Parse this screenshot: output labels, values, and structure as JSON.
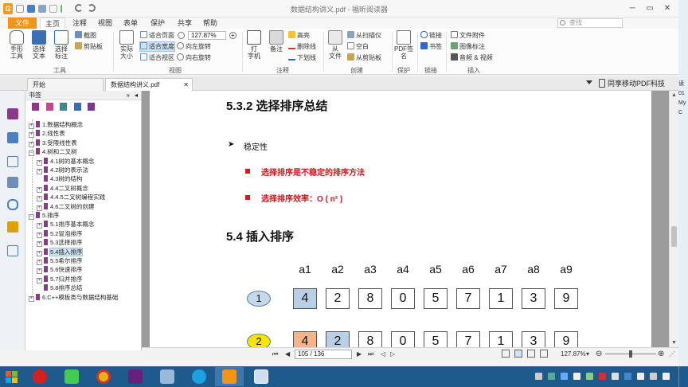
{
  "window": {
    "title": "数据结构讲义.pdf - 福昕阅读器",
    "minimize": "─",
    "restore": "▭",
    "close": "✕"
  },
  "menu": {
    "tabs": [
      "文件",
      "主页",
      "注释",
      "视图",
      "表单",
      "保护",
      "共享",
      "帮助"
    ],
    "search_placeholder": "查找"
  },
  "ribbon": {
    "tools": {
      "hand": "手形\n工具",
      "select_text": "选择\n文本",
      "select_annotation": "选择\n标注",
      "snapshot": "截图",
      "clipboard": "剪贴板",
      "group_label": "工具"
    },
    "view": {
      "actual_size": "实际\n大小",
      "fit_page": "适合页面",
      "fit_width": "适合宽度",
      "fit_visible": "适合视区",
      "zoom_value": "127.87%",
      "rotate_left": "向左旋转",
      "rotate_right": "向右旋转",
      "group_label": "视图"
    },
    "comment": {
      "typewriter": "打\n字机",
      "note": "备注",
      "highlight": "高亮",
      "strikeout": "删除线",
      "underline": "下划线",
      "group_label": "注释"
    },
    "create": {
      "from_file": "从\n文件",
      "from_scanner": "从扫描仪",
      "blank": "空白",
      "from_clipboard": "从剪贴板",
      "group_label": "创建"
    },
    "protect": {
      "pdf_sign": "PDF签\n名",
      "group_label": "保护"
    },
    "links": {
      "link": "链接",
      "bookmark": "书签",
      "group_label": "链接"
    },
    "insert": {
      "file_attachment": "文件附件",
      "image_annotation": "图像标注",
      "audio_video": "音频 & 视频",
      "group_label": "插入"
    }
  },
  "doc_tabs": [
    {
      "label": "开始",
      "close": ""
    },
    {
      "label": "数据结构讲义.pdf",
      "close": "✕"
    }
  ],
  "share_label": "同享移动PDF科技",
  "bookmarks": {
    "title": "书签",
    "items": [
      {
        "label": "1.数据结构概念",
        "level": 0,
        "expander": "+"
      },
      {
        "label": "2.线性表",
        "level": 0,
        "expander": "+"
      },
      {
        "label": "3.受限线性表",
        "level": 0,
        "expander": "+"
      },
      {
        "label": "4.树和二叉树",
        "level": 0,
        "expander": "−"
      },
      {
        "label": "4.1树的基本概念",
        "level": 1,
        "expander": "+"
      },
      {
        "label": "4.2树的表示法",
        "level": 1,
        "expander": "+"
      },
      {
        "label": "4.3树的结构",
        "level": 1,
        "expander": ""
      },
      {
        "label": "4.4二叉树概念",
        "level": 1,
        "expander": "+"
      },
      {
        "label": "4.4.5二叉树编程实践",
        "level": 1,
        "expander": "+"
      },
      {
        "label": "4.6二叉树的创建",
        "level": 1,
        "expander": "+"
      },
      {
        "label": "5.排序",
        "level": 0,
        "expander": "−"
      },
      {
        "label": "5.1排序基本概念",
        "level": 1,
        "expander": "+"
      },
      {
        "label": "5.2冒泡排序",
        "level": 1,
        "expander": "+"
      },
      {
        "label": "5.3选择排序",
        "level": 1,
        "expander": "+"
      },
      {
        "label": "5.4插入排序",
        "level": 1,
        "expander": "+",
        "selected": true
      },
      {
        "label": "5.5希尔排序",
        "level": 1,
        "expander": "+"
      },
      {
        "label": "5.6快速排序",
        "level": 1,
        "expander": "+"
      },
      {
        "label": "5.7归并排序",
        "level": 1,
        "expander": "+"
      },
      {
        "label": "5.8排序总结",
        "level": 1,
        "expander": ""
      },
      {
        "label": "6.C++模板类与数据结构基础",
        "level": 0,
        "expander": "+"
      }
    ]
  },
  "page": {
    "heading1": "5.3.2 选择排序总结",
    "bullet_marker": "➤",
    "bullet1": "稳定性",
    "red1": "选择排序是不稳定的排序方法",
    "red2": "选择排序效率：O ( n² )",
    "heading2": "5.4 插入排序",
    "columns": [
      "a1",
      "a2",
      "a3",
      "a4",
      "a5",
      "a6",
      "a7",
      "a8",
      "a9"
    ],
    "rows": [
      {
        "step": "1",
        "values": [
          "4",
          "2",
          "8",
          "0",
          "5",
          "7",
          "1",
          "3",
          "9"
        ],
        "highlight": [
          0
        ],
        "highlight_color": "blue"
      },
      {
        "step": "2",
        "values": [
          "4",
          "2",
          "8",
          "0",
          "5",
          "7",
          "1",
          "3",
          "9"
        ],
        "highlight": [
          0,
          1
        ]
      }
    ]
  },
  "statusbar": {
    "page_value": "105 / 136",
    "zoom": "127.87%",
    "zoom_out": "⊖",
    "zoom_in": "⊕"
  },
  "right_strip": [
    "读",
    "01",
    "My",
    "C"
  ],
  "colors": {
    "accent": "#f29418",
    "red_text": "#d4141c",
    "highlight_blue": "#b8cfe6",
    "highlight_orange": "#f6b48a",
    "oval_blue": "#c5d9ec",
    "oval_yellow": "#f5e600",
    "taskbar": "#1e5a8c"
  },
  "taskbar": {
    "apps": [
      "record-icon",
      "qt-icon",
      "chrome-icon",
      "visual-studio-icon",
      "paint-icon",
      "ie-icon",
      "foxit-icon",
      "window-icon"
    ]
  }
}
